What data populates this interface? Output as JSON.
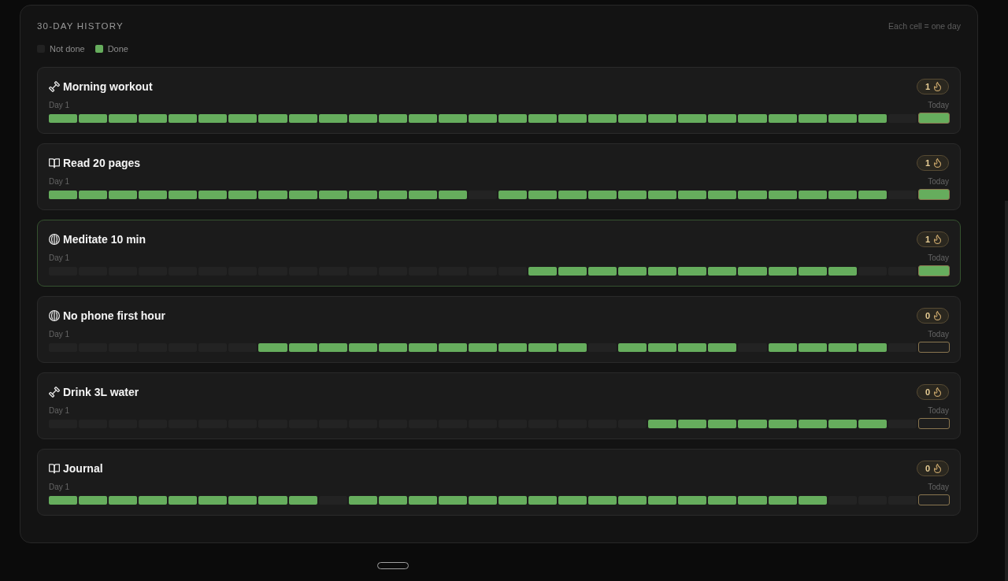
{
  "panel": {
    "title": "30-DAY HISTORY",
    "note": "Each cell = one day",
    "legend": [
      {
        "label": "Not done",
        "kind": "empty"
      },
      {
        "label": "Done",
        "kind": "done"
      }
    ],
    "habits": [
      {
        "name": "Morning workout",
        "kind": "health",
        "streak": "1",
        "selected": false,
        "start_label": "Day 1",
        "end_label": "Today",
        "days": [
          {
            "done": true
          },
          {
            "done": true
          },
          {
            "done": true
          },
          {
            "done": true
          },
          {
            "done": true
          },
          {
            "done": true
          },
          {
            "done": true
          },
          {
            "done": true
          },
          {
            "done": true
          },
          {
            "done": true
          },
          {
            "done": true
          },
          {
            "done": true
          },
          {
            "done": true
          },
          {
            "done": true
          },
          {
            "done": true
          },
          {
            "done": true
          },
          {
            "done": true
          },
          {
            "done": true
          },
          {
            "done": true
          },
          {
            "done": true
          },
          {
            "done": true
          },
          {
            "done": true
          },
          {
            "done": true
          },
          {
            "done": true
          },
          {
            "done": true
          },
          {
            "done": true
          },
          {
            "done": true
          },
          {
            "done": true
          },
          {
            "done": false
          },
          {
            "done": true
          }
        ]
      },
      {
        "name": "Read 20 pages",
        "kind": "learning",
        "streak": "1",
        "selected": false,
        "start_label": "Day 1",
        "end_label": "Today",
        "days": [
          {
            "done": true
          },
          {
            "done": true
          },
          {
            "done": true
          },
          {
            "done": true
          },
          {
            "done": true
          },
          {
            "done": true
          },
          {
            "done": true
          },
          {
            "done": true
          },
          {
            "done": true
          },
          {
            "done": true
          },
          {
            "done": true
          },
          {
            "done": true
          },
          {
            "done": true
          },
          {
            "done": true
          },
          {
            "done": false
          },
          {
            "done": true
          },
          {
            "done": true
          },
          {
            "done": true
          },
          {
            "done": true
          },
          {
            "done": true
          },
          {
            "done": true
          },
          {
            "done": true
          },
          {
            "done": true
          },
          {
            "done": true
          },
          {
            "done": true
          },
          {
            "done": true
          },
          {
            "done": true
          },
          {
            "done": true
          },
          {
            "done": false
          },
          {
            "done": true
          }
        ]
      },
      {
        "name": "Meditate 10 min",
        "kind": "mind",
        "streak": "1",
        "selected": true,
        "start_label": "Day 1",
        "end_label": "Today",
        "days": [
          {
            "done": false
          },
          {
            "done": false
          },
          {
            "done": false
          },
          {
            "done": false
          },
          {
            "done": false
          },
          {
            "done": false
          },
          {
            "done": false
          },
          {
            "done": false
          },
          {
            "done": false
          },
          {
            "done": false
          },
          {
            "done": false
          },
          {
            "done": false
          },
          {
            "done": false
          },
          {
            "done": false
          },
          {
            "done": false
          },
          {
            "done": false
          },
          {
            "done": true
          },
          {
            "done": true
          },
          {
            "done": true
          },
          {
            "done": true
          },
          {
            "done": true
          },
          {
            "done": true
          },
          {
            "done": true
          },
          {
            "done": true
          },
          {
            "done": true
          },
          {
            "done": true
          },
          {
            "done": true
          },
          {
            "done": false
          },
          {
            "done": false
          },
          {
            "done": true
          }
        ]
      },
      {
        "name": "No phone first hour",
        "kind": "mind",
        "streak": "0",
        "selected": false,
        "start_label": "Day 1",
        "end_label": "Today",
        "days": [
          {
            "done": false
          },
          {
            "done": false
          },
          {
            "done": false
          },
          {
            "done": false
          },
          {
            "done": false
          },
          {
            "done": false
          },
          {
            "done": false
          },
          {
            "done": true
          },
          {
            "done": true
          },
          {
            "done": true
          },
          {
            "done": true
          },
          {
            "done": true
          },
          {
            "done": true
          },
          {
            "done": true
          },
          {
            "done": true
          },
          {
            "done": true
          },
          {
            "done": true
          },
          {
            "done": true
          },
          {
            "done": false
          },
          {
            "done": true
          },
          {
            "done": true
          },
          {
            "done": true
          },
          {
            "done": true
          },
          {
            "done": false
          },
          {
            "done": true
          },
          {
            "done": true
          },
          {
            "done": true
          },
          {
            "done": true
          },
          {
            "done": false
          },
          {
            "done": false
          }
        ]
      },
      {
        "name": "Drink 3L water",
        "kind": "health",
        "streak": "0",
        "selected": false,
        "start_label": "Day 1",
        "end_label": "Today",
        "days": [
          {
            "done": false
          },
          {
            "done": false
          },
          {
            "done": false
          },
          {
            "done": false
          },
          {
            "done": false
          },
          {
            "done": false
          },
          {
            "done": false
          },
          {
            "done": false
          },
          {
            "done": false
          },
          {
            "done": false
          },
          {
            "done": false
          },
          {
            "done": false
          },
          {
            "done": false
          },
          {
            "done": false
          },
          {
            "done": false
          },
          {
            "done": false
          },
          {
            "done": false
          },
          {
            "done": false
          },
          {
            "done": false
          },
          {
            "done": false
          },
          {
            "done": true
          },
          {
            "done": true
          },
          {
            "done": true
          },
          {
            "done": true
          },
          {
            "done": true
          },
          {
            "done": true
          },
          {
            "done": true
          },
          {
            "done": true
          },
          {
            "done": false
          },
          {
            "done": false
          }
        ]
      },
      {
        "name": "Journal",
        "kind": "learning",
        "streak": "0",
        "selected": false,
        "start_label": "Day 1",
        "end_label": "Today",
        "days": [
          {
            "done": true
          },
          {
            "done": true
          },
          {
            "done": true
          },
          {
            "done": true
          },
          {
            "done": true
          },
          {
            "done": true
          },
          {
            "done": true
          },
          {
            "done": true
          },
          {
            "done": true
          },
          {
            "done": false
          },
          {
            "done": true
          },
          {
            "done": true
          },
          {
            "done": true
          },
          {
            "done": true
          },
          {
            "done": true
          },
          {
            "done": true
          },
          {
            "done": true
          },
          {
            "done": true
          },
          {
            "done": true
          },
          {
            "done": true
          },
          {
            "done": true
          },
          {
            "done": true
          },
          {
            "done": true
          },
          {
            "done": true
          },
          {
            "done": true
          },
          {
            "done": true
          },
          {
            "done": false
          },
          {
            "done": false
          },
          {
            "done": false
          },
          {
            "done": false
          }
        ]
      }
    ]
  }
}
